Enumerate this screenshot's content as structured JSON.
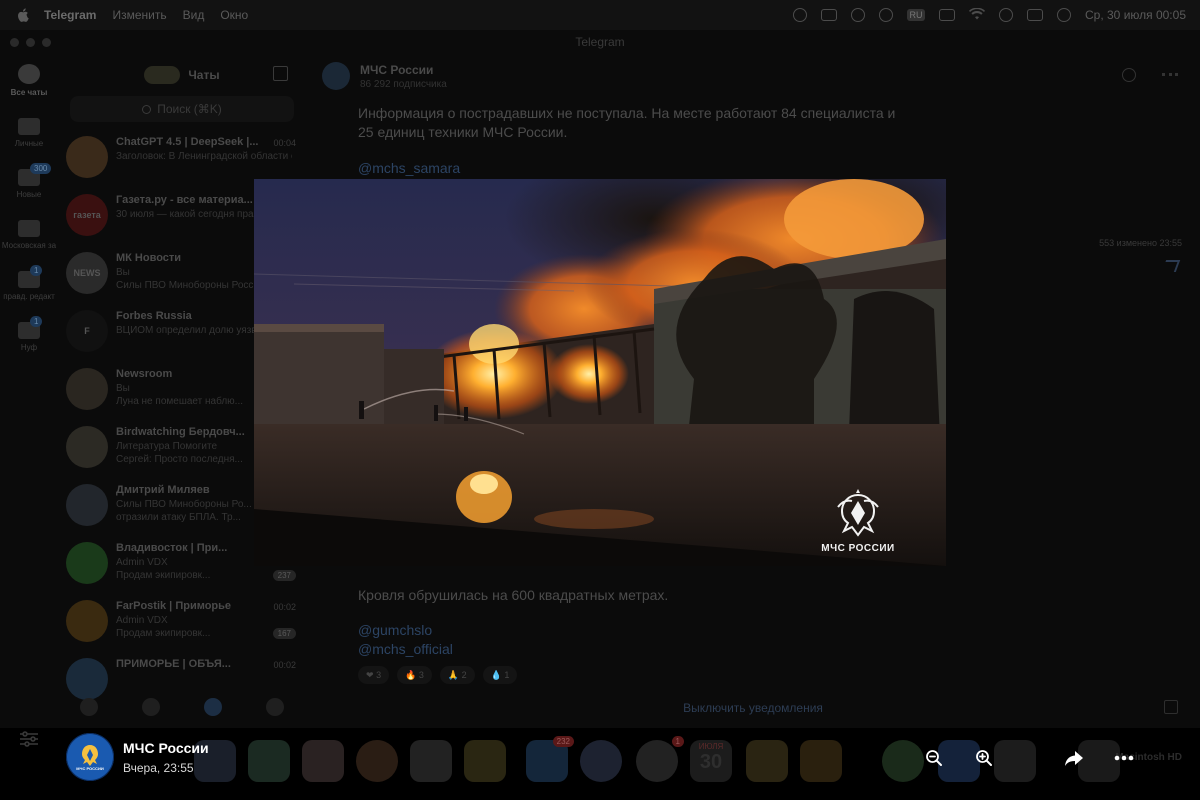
{
  "menubar": {
    "app_name": "Telegram",
    "menus": [
      "Изменить",
      "Вид",
      "Окно"
    ],
    "keyboard_layout": "RU",
    "clock": "Ср, 30 июля  00:05"
  },
  "window": {
    "title": "Telegram"
  },
  "folders": [
    {
      "label": "Все чаты",
      "active": true
    },
    {
      "label": "Личные"
    },
    {
      "label": "Новые",
      "badge": "300"
    },
    {
      "label": "Московская за"
    },
    {
      "label": "правд. редакт",
      "badge": "1"
    },
    {
      "label": "Нуф",
      "badge": "1"
    }
  ],
  "chat_list": {
    "header": "Чаты",
    "search_placeholder": "Поиск (⌘K)",
    "chats": [
      {
        "title": "ChatGPT 4.5 | DeepSeek |...",
        "preview": "Заголовок: В Ленинградской области обрушилась кровля гора...",
        "time": "00:04",
        "avatar_color": "#3a2a1a"
      },
      {
        "title": "Газета.ру - все материа...",
        "preview": "30 июля — какой сегодня праздник? Что отмечают в...",
        "time": "",
        "avatar_color": "#3a1010",
        "avatar_text": "газета"
      },
      {
        "title": "МК Новости",
        "preview": "Вы\nСилы ПВО Минобороны Росс...",
        "time": "",
        "avatar_color": "#2a2a2a",
        "avatar_text": "NEWS"
      },
      {
        "title": "Forbes Russia",
        "preview": "ВЦИОМ определил долю уязвимых для «черных кр...",
        "time": "",
        "avatar_color": "#111111",
        "avatar_text": "F"
      },
      {
        "title": "Newsroom",
        "preview": "Вы\nЛуна не помешает наблю...",
        "time": "",
        "avatar_color": "#2a2620"
      },
      {
        "title": "Birdwatching Бердовч...",
        "preview": "Литература  Помогите\nСергей: Просто последня...",
        "time": "",
        "avatar_color": "#2c2a24"
      },
      {
        "title": "Дмитрий Миляев",
        "preview": "Силы ПВО Минобороны Ро...\nотразили атаку БПЛА. Тр...",
        "time": "",
        "avatar_color": "#22262c"
      },
      {
        "title": "Владивосток | При...",
        "preview": "Admin VDX\nПродам экипировк...",
        "time": "",
        "count": "237",
        "avatar_color": "#1a3a1a"
      },
      {
        "title": "FarPostik | Приморье",
        "preview": "Admin VDX\nПродам экипировк...",
        "time": "00:02",
        "count": "167",
        "avatar_color": "#3a2a10"
      },
      {
        "title": "ПРИМОРЬЕ | ОБЪЯ...",
        "preview": "",
        "time": "00:02",
        "avatar_color": "#1a2a3a"
      }
    ]
  },
  "chat": {
    "name": "МЧС России",
    "subscribers": "86 292 подписчика",
    "message_text": "Информация о пострадавших не поступала. На месте работают 84 специалиста и 25 единиц техники МЧС России.",
    "message_link": "@mchs_samara",
    "views": "553 изменено 23:55",
    "message2_text": "Кровля обрушилась на 600 квадратных метрах.",
    "message2_links": [
      "@gumchslo",
      "@mchs_official"
    ],
    "reactions": [
      {
        "emoji": "❤",
        "count": "3"
      },
      {
        "emoji": "🔥",
        "count": "3"
      },
      {
        "emoji": "🙏",
        "count": "2"
      },
      {
        "emoji": "💧",
        "count": "1"
      }
    ],
    "mute_label": "Выключить уведомления"
  },
  "dock": {
    "telegram_badge": "232",
    "settings_badge": "1",
    "calendar_month": "ИЮЛЯ",
    "calendar_day": "30",
    "right_label": "Macintosh HD"
  },
  "viewer": {
    "watermark": "МЧС РОССИИ",
    "sender": "МЧС России",
    "date": "Вчера, 23:55",
    "avatar_caption": "МЧС РОССИИ"
  },
  "colors": {
    "viewer_avatar": "#1a5ab0",
    "link": "#2c4464"
  }
}
